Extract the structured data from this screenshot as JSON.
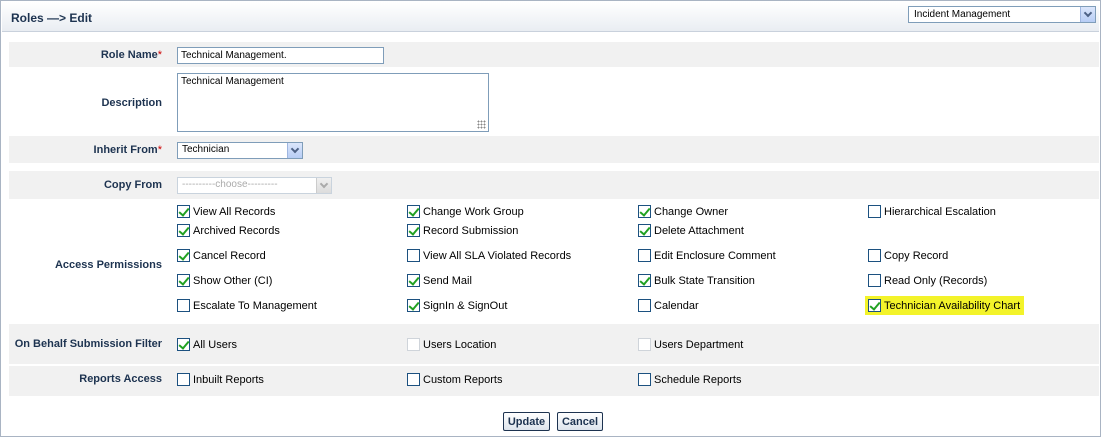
{
  "header": {
    "title": "Roles —> Edit",
    "module_select": "Incident Management"
  },
  "form": {
    "role_name": {
      "label": "Role Name",
      "required_mark": "*",
      "value": "Technical Management."
    },
    "description": {
      "label": "Description",
      "value": "Technical Management"
    },
    "inherit_from": {
      "label": "Inherit From",
      "required_mark": "*",
      "value": "Technician"
    },
    "copy_from": {
      "label": "Copy From",
      "value": "----------choose---------"
    }
  },
  "access_permissions": {
    "label": "Access Permissions",
    "items": [
      {
        "label": "View All Records",
        "checked": true
      },
      {
        "label": "Change Work Group",
        "checked": true
      },
      {
        "label": "Change Owner",
        "checked": true
      },
      {
        "label": "Hierarchical Escalation",
        "checked": false
      },
      {
        "label": "Archived Records",
        "checked": true
      },
      {
        "label": "Record Submission",
        "checked": true
      },
      {
        "label": "Delete Attachment",
        "checked": true
      },
      {
        "label": "Cancel Record",
        "checked": true
      },
      {
        "label": "View All SLA Violated Records",
        "checked": false
      },
      {
        "label": "Edit Enclosure Comment",
        "checked": false
      },
      {
        "label": "Copy Record",
        "checked": false
      },
      {
        "label": "Show Other (CI)",
        "checked": true
      },
      {
        "label": "Send Mail",
        "checked": true
      },
      {
        "label": "Bulk State Transition",
        "checked": true
      },
      {
        "label": "Read Only (Records)",
        "checked": false
      },
      {
        "label": "Escalate To Management",
        "checked": false
      },
      {
        "label": "SignIn & SignOut",
        "checked": true
      },
      {
        "label": "Calendar",
        "checked": false
      },
      {
        "label": "Technician Availability Chart",
        "checked": true,
        "highlighted": true
      }
    ]
  },
  "on_behalf": {
    "label": "On Behalf Submission Filter",
    "items": [
      {
        "label": "All Users",
        "checked": true,
        "disabled": false
      },
      {
        "label": "Users Location",
        "checked": false,
        "disabled": true
      },
      {
        "label": "Users Department",
        "checked": false,
        "disabled": true
      }
    ]
  },
  "reports_access": {
    "label": "Reports Access",
    "items": [
      {
        "label": "Inbuilt Reports",
        "checked": false
      },
      {
        "label": "Custom Reports",
        "checked": false
      },
      {
        "label": "Schedule Reports",
        "checked": false
      }
    ]
  },
  "buttons": {
    "update": "Update",
    "cancel": "Cancel"
  },
  "colors": {
    "label_text": "#1d3350",
    "check_mark": "#21a121",
    "highlight": "#f3f32a",
    "band": "#f1f1f1"
  }
}
